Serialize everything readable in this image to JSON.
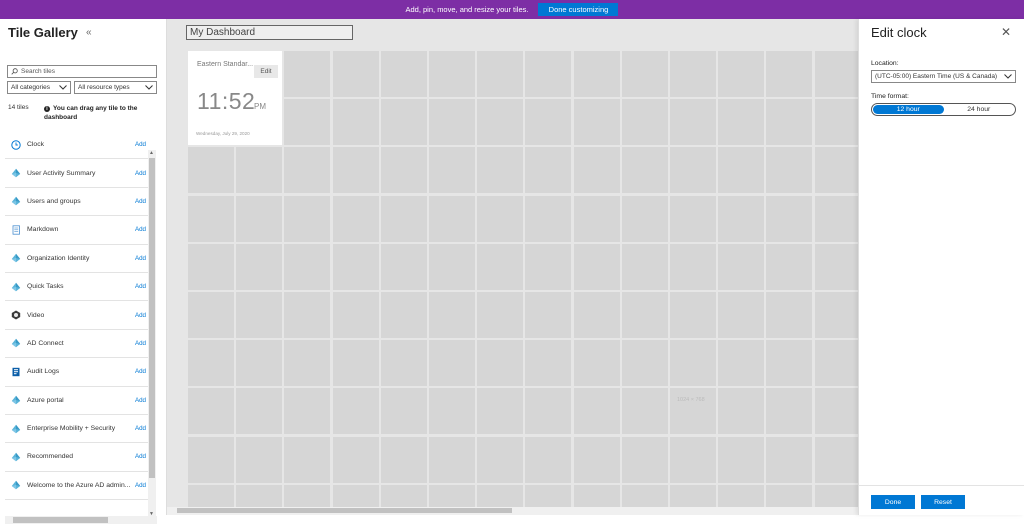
{
  "banner": {
    "message": "Add, pin, move, and resize your tiles.",
    "done_label": "Done customizing"
  },
  "gallery": {
    "title": "Tile Gallery",
    "collapse_glyph": "«",
    "search_placeholder": "Search tiles",
    "category_filter": "All categories",
    "resource_filter": "All resource types",
    "count_label": "14 tiles",
    "hint": "You can drag any tile to the dashboard",
    "add_label": "Add",
    "tiles": [
      {
        "name": "Clock",
        "icon": "clock-icon"
      },
      {
        "name": "User Activity Summary",
        "icon": "azure-ad-icon"
      },
      {
        "name": "Users and groups",
        "icon": "azure-ad-icon"
      },
      {
        "name": "Markdown",
        "icon": "document-icon"
      },
      {
        "name": "Organization Identity",
        "icon": "azure-ad-icon"
      },
      {
        "name": "Quick Tasks",
        "icon": "azure-ad-icon"
      },
      {
        "name": "Video",
        "icon": "video-icon"
      },
      {
        "name": "AD Connect",
        "icon": "azure-ad-icon"
      },
      {
        "name": "Audit Logs",
        "icon": "audit-log-icon"
      },
      {
        "name": "Azure portal",
        "icon": "azure-ad-icon"
      },
      {
        "name": "Enterprise Mobility + Security",
        "icon": "azure-ad-icon"
      },
      {
        "name": "Recommended",
        "icon": "azure-ad-icon"
      },
      {
        "name": "Welcome to the Azure AD admin...",
        "icon": "azure-ad-icon"
      }
    ]
  },
  "dashboard": {
    "name": "My Dashboard",
    "size_hint": "1024 × 768",
    "clock_tile": {
      "location": "Eastern Standar...",
      "edit_label": "Edit",
      "time": "11:52",
      "ampm": "PM",
      "date": "Wednesday, July 29, 2020"
    }
  },
  "edit_panel": {
    "title": "Edit clock",
    "close_glyph": "✕",
    "location_label": "Location:",
    "location_value": "(UTC-05:00) Eastern Time (US & Canada)",
    "time_format_label": "Time format:",
    "format_12": "12 hour",
    "format_24": "24 hour",
    "selected_format": "12 hour",
    "done_label": "Done",
    "reset_label": "Reset"
  },
  "colors": {
    "banner": "#7d2ea5",
    "accent": "#0078d4",
    "tile_empty": "#d6d6d6",
    "canvas": "#e6e6e6"
  }
}
